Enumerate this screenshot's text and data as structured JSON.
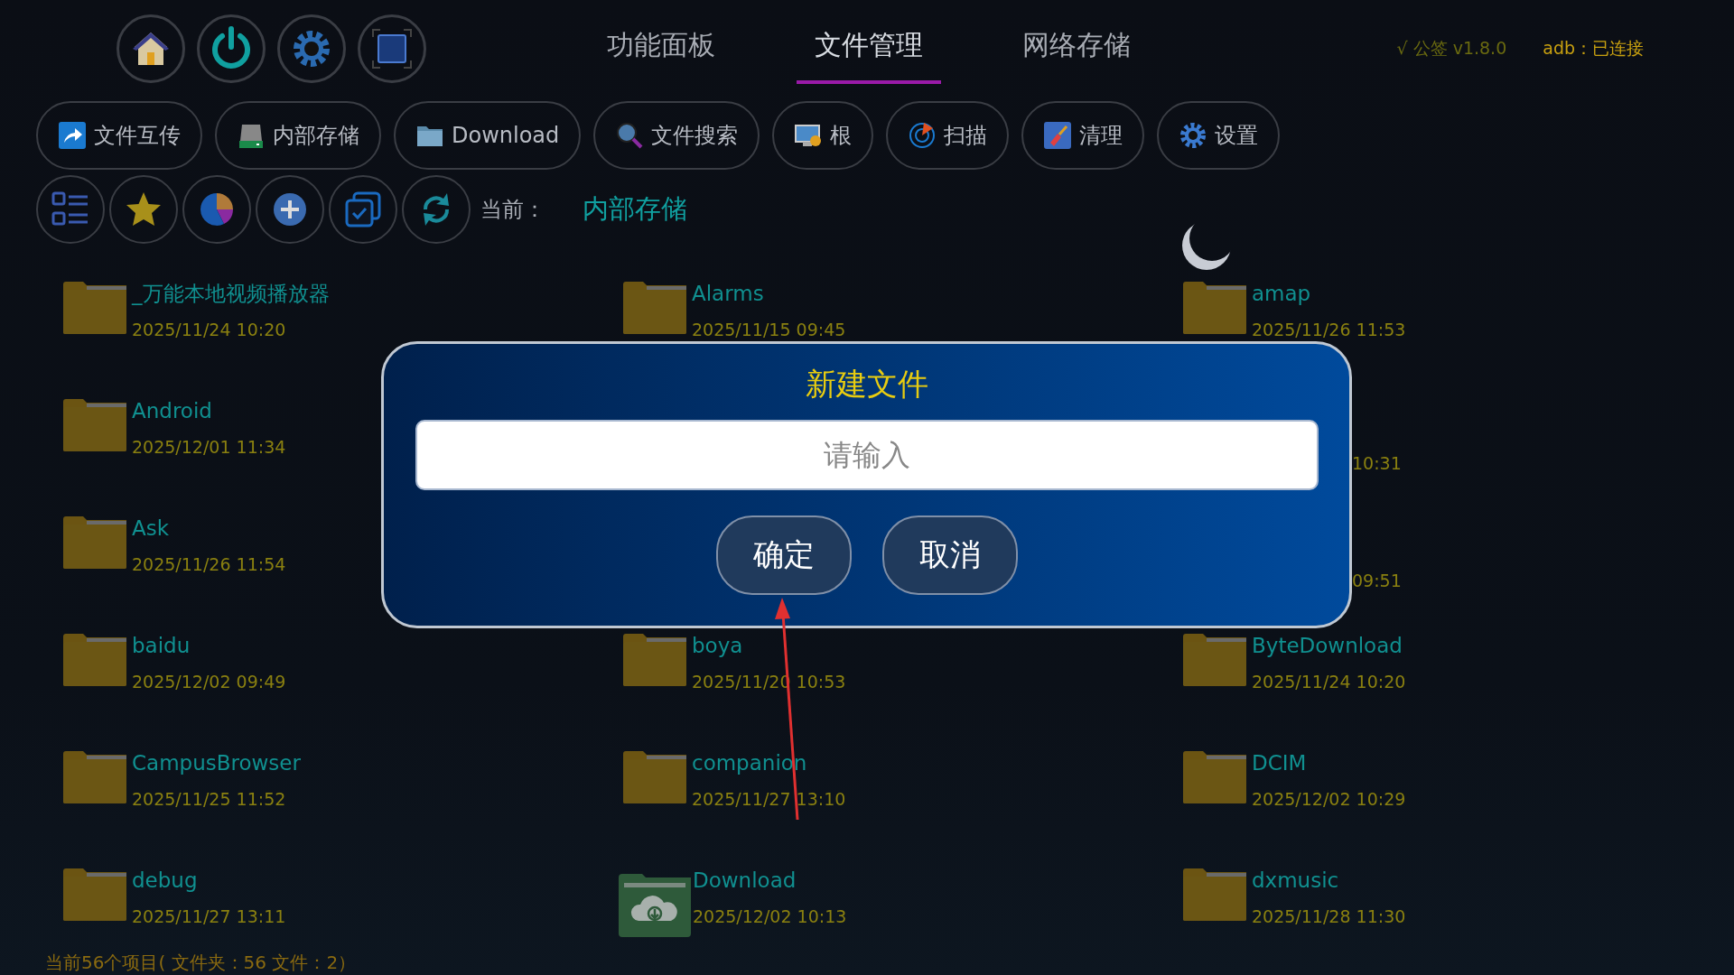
{
  "tabs": [
    {
      "label": "功能面板",
      "selected": false
    },
    {
      "label": "文件管理",
      "selected": true
    },
    {
      "label": "网络存储",
      "selected": false
    }
  ],
  "version": "√ 公签 v1.8.0",
  "adb_status": "adb：已连接",
  "shortcuts": [
    {
      "label": "文件互传"
    },
    {
      "label": "内部存储"
    },
    {
      "label": "Download"
    },
    {
      "label": "文件搜索"
    },
    {
      "label": "根"
    },
    {
      "label": "扫描"
    },
    {
      "label": "清理"
    },
    {
      "label": "设置"
    }
  ],
  "current": {
    "label": "当前：",
    "path": "内部存储"
  },
  "files": [
    [
      {
        "kind": "folder",
        "name": "_万能本地视频播放器",
        "date": "2025/11/24 10:20"
      },
      {
        "kind": "folder",
        "name": "Alarms",
        "date": "2025/11/15 09:45"
      },
      {
        "kind": "folder",
        "name": "amap",
        "date": "2025/11/26 11:53"
      }
    ],
    [
      {
        "kind": "folder",
        "name": "Android",
        "date": "2025/12/01 11:34"
      },
      {
        "kind": "covered",
        "date": "10:31"
      }
    ],
    [
      {
        "kind": "folder",
        "name": "Ask",
        "date": "2025/11/26 11:54"
      },
      {
        "kind": "covered",
        "date": "09:51"
      }
    ],
    [
      {
        "kind": "folder",
        "name": "baidu",
        "date": "2025/12/02 09:49"
      },
      {
        "kind": "folder",
        "name": "boya",
        "date": "2025/11/20 10:53"
      },
      {
        "kind": "folder",
        "name": "ByteDownload",
        "date": "2025/11/24 10:20"
      }
    ],
    [
      {
        "kind": "folder",
        "name": "CampusBrowser",
        "date": "2025/11/25 11:52"
      },
      {
        "kind": "folder",
        "name": "companion",
        "date": "2025/11/27 13:10"
      },
      {
        "kind": "folder",
        "name": "DCIM",
        "date": "2025/12/02 10:29"
      }
    ],
    [
      {
        "kind": "folder",
        "name": "debug",
        "date": "2025/11/27 13:11"
      },
      {
        "kind": "cloud-folder",
        "name": "Download",
        "date": "2025/12/02 10:13"
      },
      {
        "kind": "folder",
        "name": "dxmusic",
        "date": "2025/11/28 11:30"
      }
    ]
  ],
  "status": "当前56个项目( 文件夹：56  文件：2）",
  "dialog": {
    "title": "新建文件",
    "placeholder": "请输入",
    "buttons": [
      "确定",
      "取消"
    ]
  }
}
